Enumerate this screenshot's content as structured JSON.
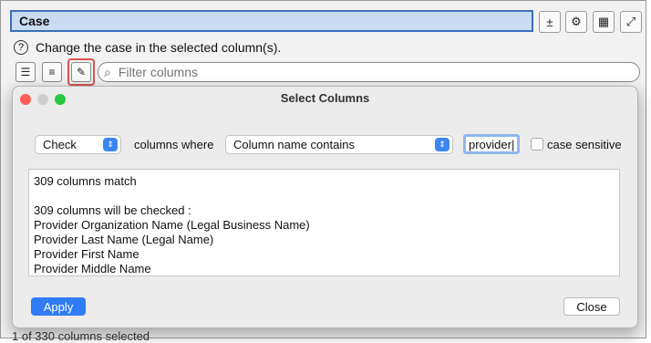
{
  "window": {
    "title": "Case",
    "help_text": "Change the case in the selected column(s).",
    "filter_placeholder": "Filter columns",
    "status_text": "1 of 330 columns selected"
  },
  "toolbar_icons": [
    "calculator-icon",
    "gear-icon",
    "table-icon",
    "expand-icon"
  ],
  "tool_icons": [
    "checklist-icon",
    "list-icon",
    "magic-wand-icon"
  ],
  "dialog": {
    "title": "Select Columns",
    "action_select": "Check",
    "columns_where_label": "columns where",
    "condition_select": "Column name contains",
    "search_value": "provider",
    "case_sensitive_label": "case sensitive",
    "results": [
      "309 columns match",
      "",
      "309 columns will be checked :",
      "Provider Organization Name (Legal Business Name)",
      "Provider Last Name (Legal Name)",
      "Provider First Name",
      "Provider Middle Name"
    ],
    "apply_label": "Apply",
    "close_label": "Close"
  },
  "colors": {
    "accent": "#2f7cf6",
    "title_bar": "#c9dcf3",
    "highlight": "#d9534f"
  }
}
